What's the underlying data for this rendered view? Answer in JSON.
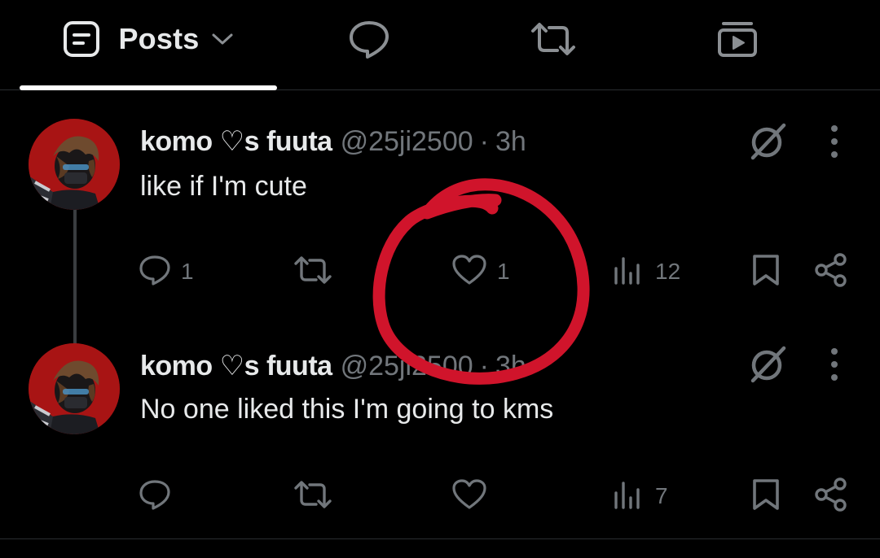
{
  "tabs": [
    {
      "label": "Posts",
      "icon": "posts-icon",
      "active": true
    },
    {
      "label": "",
      "icon": "replies-icon"
    },
    {
      "label": "",
      "icon": "reposts-icon"
    },
    {
      "label": "",
      "icon": "media-icon"
    }
  ],
  "posts": [
    {
      "name": "komo ♡s fuuta",
      "handle": "@25ji2500",
      "separator": "·",
      "time": "3h",
      "text": "like if I'm cute",
      "replies": "1",
      "reposts": "",
      "likes": "1",
      "views": "12"
    },
    {
      "name": "komo ♡s fuuta",
      "handle": "@25ji2500",
      "separator": "·",
      "time": "3h",
      "text": "No one liked this I'm going to kms",
      "replies": "",
      "reposts": "",
      "likes": "",
      "views": "7"
    }
  ],
  "colors": {
    "background": "#000000",
    "primary_text": "#e7e9ea",
    "secondary_text": "#71767b",
    "annotation_red": "#d0142b"
  }
}
